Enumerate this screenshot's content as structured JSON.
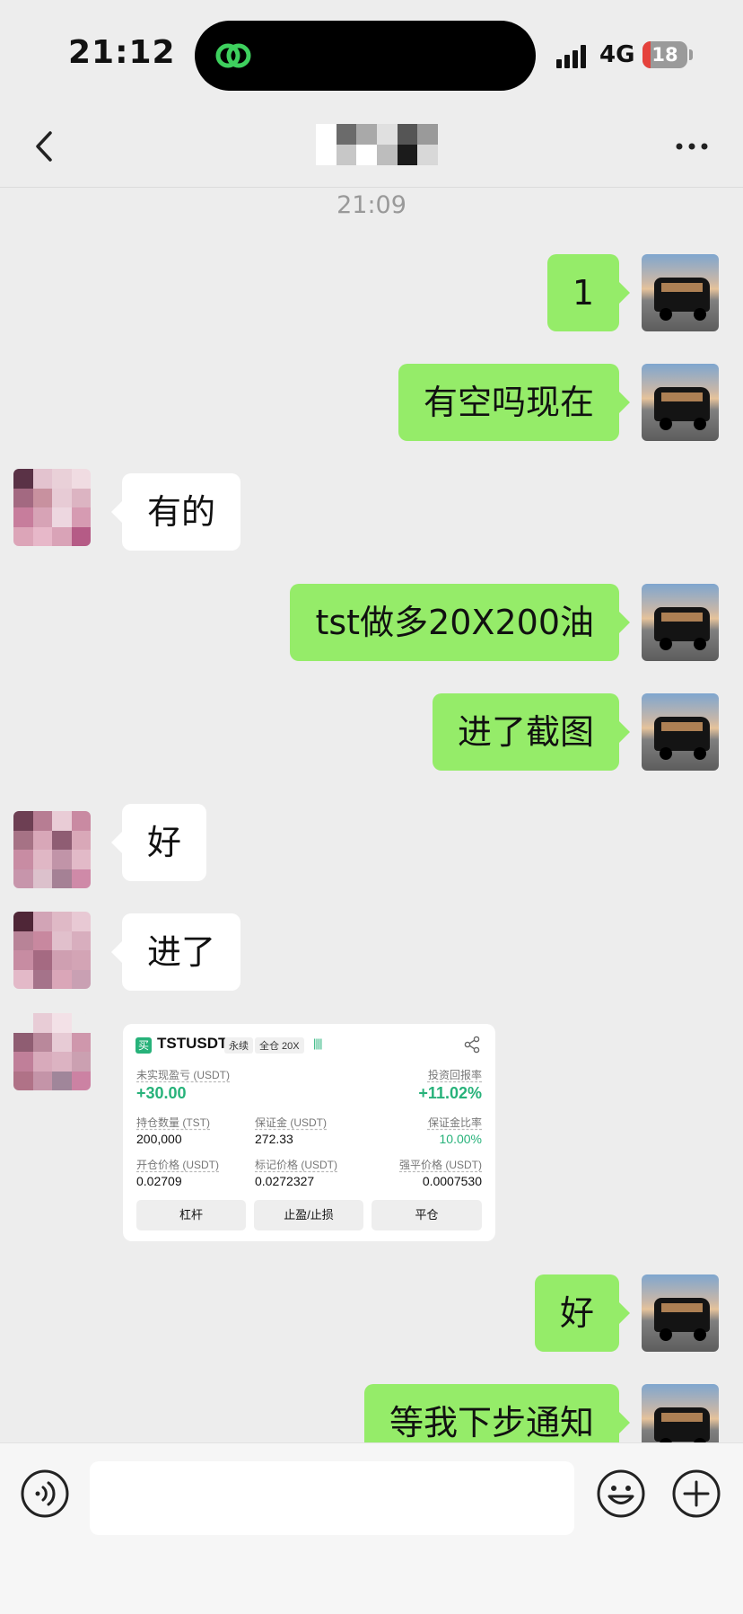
{
  "status_bar": {
    "time": "21:12",
    "network": "4G",
    "battery": "18",
    "battery_level": 0.18
  },
  "timestamp": "21:09",
  "messages": [
    {
      "from": "me",
      "text": "1"
    },
    {
      "from": "me",
      "text": "有空吗现在"
    },
    {
      "from": "them",
      "text": "有的"
    },
    {
      "from": "me",
      "text": "tst做多20X200油"
    },
    {
      "from": "me",
      "text": "进了截图"
    },
    {
      "from": "them",
      "text": "好"
    },
    {
      "from": "them",
      "text": "进了"
    },
    {
      "from": "them",
      "type": "image",
      "card": {
        "buy_tag": "买",
        "pair": "TSTUSDT",
        "tag_perpetual": "永续",
        "tag_margin": "全仓 20X",
        "signal_bars": "||||",
        "unrealized_pnl_label": "未实现盈亏 (USDT)",
        "unrealized_pnl_value": "+30.00",
        "roi_label": "投资回报率",
        "roi_value": "+11.02%",
        "position_size_label": "持仓数量 (TST)",
        "position_size_value": "200,000",
        "margin_label": "保证金 (USDT)",
        "margin_value": "272.33",
        "margin_ratio_label": "保证金比率",
        "margin_ratio_value": "10.00%",
        "entry_price_label": "开仓价格 (USDT)",
        "entry_price_value": "0.02709",
        "mark_price_label": "标记价格 (USDT)",
        "mark_price_value": "0.0272327",
        "liq_price_label": "强平价格 (USDT)",
        "liq_price_value": "0.0007530",
        "btn_leverage": "杠杆",
        "btn_tpsl": "止盈/止损",
        "btn_close": "平仓"
      }
    },
    {
      "from": "me",
      "text": "好"
    },
    {
      "from": "me",
      "text": "等我下步通知"
    }
  ],
  "input": {
    "value": ""
  },
  "colors": {
    "bubble_me": "#95ec69",
    "bubble_them": "#ffffff",
    "background": "#ededed",
    "accent_green": "#27b27a"
  },
  "icons": [
    "back-icon",
    "more-icon",
    "voice-icon",
    "emoji-icon",
    "plus-icon",
    "share-icon",
    "app-logo-icon"
  ]
}
